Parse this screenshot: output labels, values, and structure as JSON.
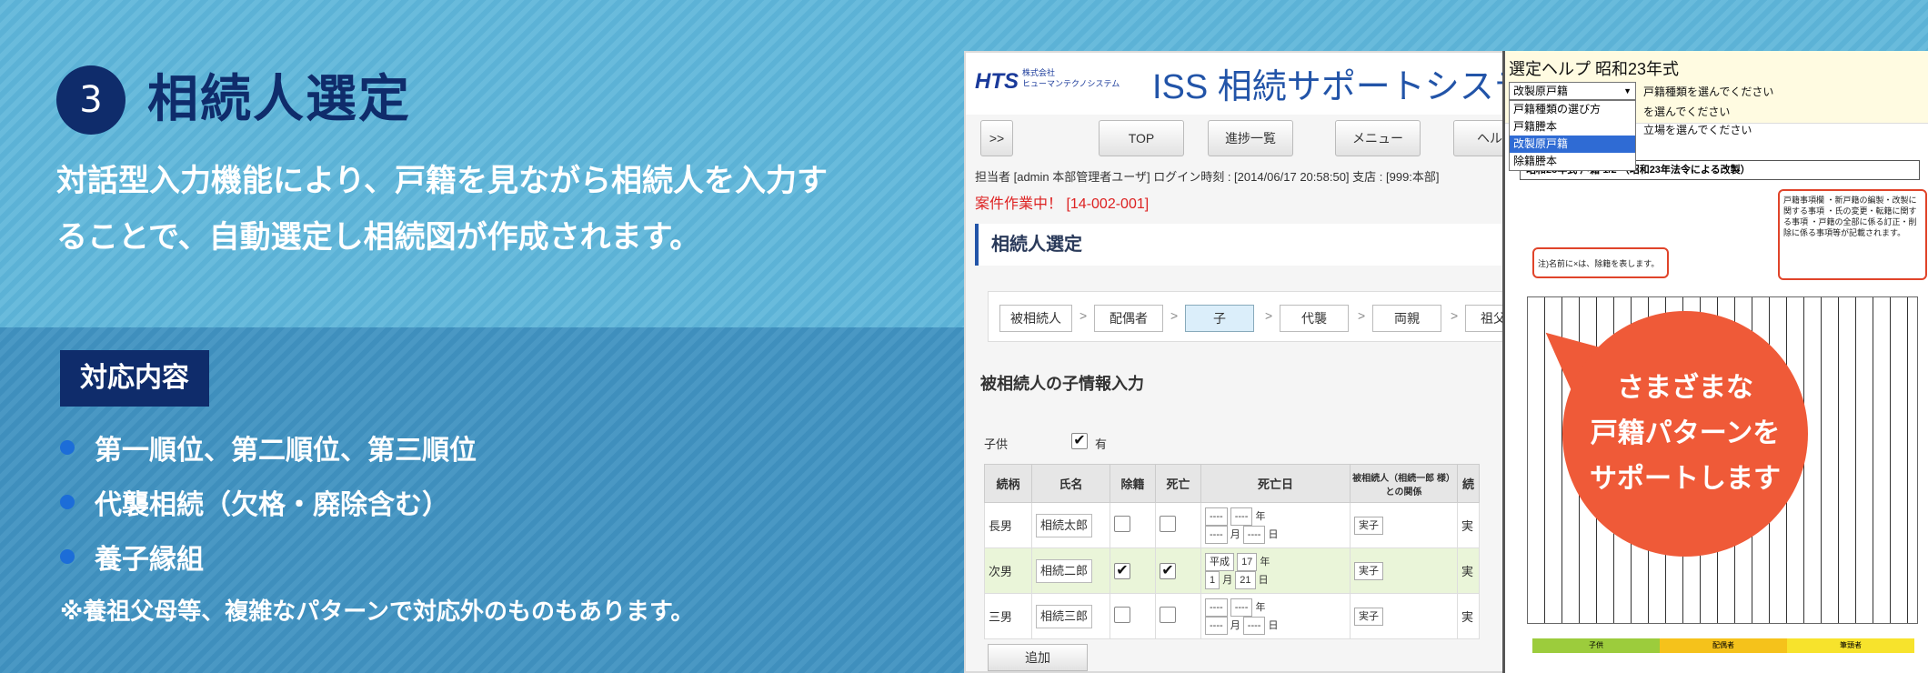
{
  "colors": {
    "navy": "#0f2c6b",
    "banner_blue": "#5cb2d6",
    "lower_blue": "#3f8fbd",
    "bubble_orange": "#ef5a38",
    "bullet_blue": "#1c6dd8"
  },
  "left": {
    "step_number": "3",
    "title": "相続人選定",
    "description_line1": "対話型入力機能により、戸籍を見ながら相続人を入力す",
    "description_line2": "ることで、自動選定し相続図が作成されます。",
    "tag": "対応内容",
    "bullets": [
      "第一順位、第二順位、第三順位",
      "代襲相続（欠格・廃除含む）",
      "養子縁組"
    ],
    "note": "※養祖父母等、複雑なパターンで対応外のものもあります。"
  },
  "app": {
    "logo": "HTS",
    "logo_sub1": "株式会社",
    "logo_sub2": "ヒューマンテクノシステム",
    "title": "ISS 相続サポートシステ",
    "nav": [
      ">>",
      "TOP",
      "進捗一覧",
      "メニュー",
      "ヘルプ"
    ],
    "info": "担当者 [admin 本部管理者ユーザ] ログイン時刻 : [2014/06/17 20:58:50] 支店 : [999:本部]",
    "work": "案件作業中！  [14-002-001]",
    "section": "相続人選定",
    "steps": [
      "被相続人",
      "配偶者",
      "子",
      "代襲",
      "両親",
      "祖父母"
    ],
    "step_sep": ">",
    "subtitle": "被相続人の子情報入力",
    "kids_label": "子供",
    "kids_check": "有",
    "check_mark": "✔",
    "table_headers": [
      "続柄",
      "氏名",
      "除籍",
      "死亡",
      "死亡日",
      "被相続人（相続一郎 様）との関係",
      "続"
    ],
    "rows": [
      {
        "rel": "長男",
        "name": "相続太郎",
        "era": "----",
        "year": "----",
        "month": "----",
        "day": "----",
        "relation": "実子",
        "last": "実"
      },
      {
        "rel": "次男",
        "name": "相続二郎",
        "era": "平成",
        "year": "17",
        "month": "1",
        "day": "21",
        "relation": "実子",
        "last": "実"
      },
      {
        "rel": "三男",
        "name": "相続三郎",
        "era": "----",
        "year": "----",
        "month": "----",
        "day": "----",
        "relation": "実子",
        "last": "実"
      }
    ],
    "unit_year": "年",
    "unit_month": "月",
    "unit_day": "日",
    "add_button": "追加"
  },
  "help": {
    "title": "選定ヘルプ 昭和23年式",
    "selected": "改製原戸籍",
    "hint1": "戸籍種類を選んでください",
    "hint2": "を選んでください",
    "hint3": "立場を選んでください",
    "options": [
      "戸籍種類の選び方",
      "戸籍謄本",
      "改製原戸籍",
      "除籍謄本"
    ],
    "doc_bar": "昭和23年式  戸籍  1/2    （昭和23年法令による改製）",
    "note_small": "注)名前に×は、除籍を表します。",
    "note_right": "戸籍事項欄 ・新戸籍の編製・改製に関する事項 ・氏の変更・転籍に関する事項 ・戸籍の全部に係る訂正・削除に係る事項等が記載されます。",
    "legend": [
      "子供",
      "配偶者",
      "筆頭者"
    ],
    "bubble_line1": "さまざまな",
    "bubble_line2": "戸籍パターンを",
    "bubble_line3": "サポートします"
  }
}
